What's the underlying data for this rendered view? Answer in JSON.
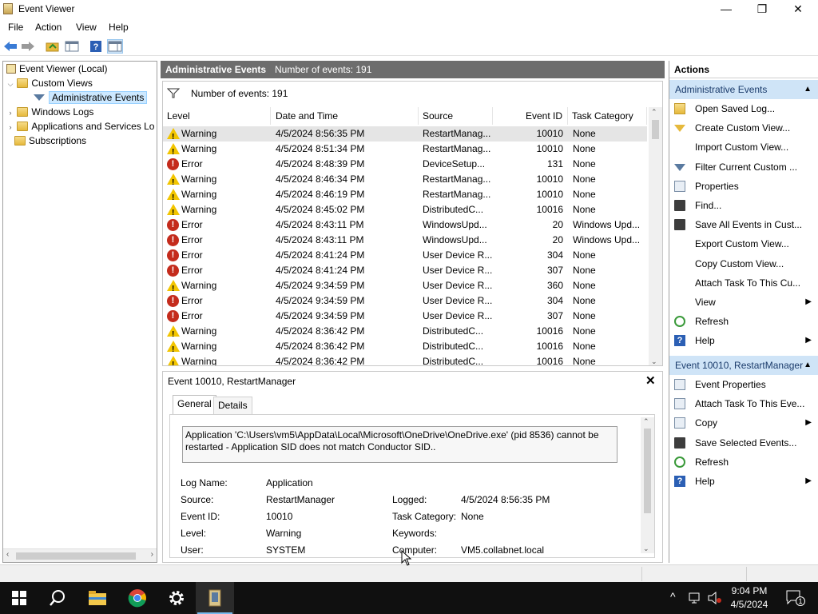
{
  "window": {
    "title": "Event Viewer",
    "minimize_glyph": "—",
    "maximize_glyph": "❐",
    "close_glyph": "✕"
  },
  "menu": [
    "File",
    "Action",
    "View",
    "Help"
  ],
  "toolbar": {
    "icons": [
      "back-arrow-icon",
      "forward-arrow-icon",
      "open-folder-icon",
      "show-hide-tree-icon",
      "help-icon",
      "show-hide-action-pane-icon"
    ]
  },
  "tree": {
    "root": "Event Viewer (Local)",
    "custom_views": "Custom Views",
    "administrative_events": "Administrative Events",
    "windows_logs": "Windows Logs",
    "apps_services": "Applications and Services Lo",
    "subscriptions": "Subscriptions"
  },
  "middle": {
    "header_title": "Administrative Events",
    "header_count": "Number of events: 191",
    "filter_text": "Number of events: 191",
    "columns": {
      "level": "Level",
      "date": "Date and Time",
      "source": "Source",
      "event_id": "Event ID",
      "task": "Task Category"
    },
    "events": [
      {
        "level": "Warning",
        "date": "4/5/2024 8:56:35 PM",
        "source": "RestartManag...",
        "id": "10010",
        "task": "None"
      },
      {
        "level": "Warning",
        "date": "4/5/2024 8:51:34 PM",
        "source": "RestartManag...",
        "id": "10010",
        "task": "None"
      },
      {
        "level": "Error",
        "date": "4/5/2024 8:48:39 PM",
        "source": "DeviceSetup...",
        "id": "131",
        "task": "None"
      },
      {
        "level": "Warning",
        "date": "4/5/2024 8:46:34 PM",
        "source": "RestartManag...",
        "id": "10010",
        "task": "None"
      },
      {
        "level": "Warning",
        "date": "4/5/2024 8:46:19 PM",
        "source": "RestartManag...",
        "id": "10010",
        "task": "None"
      },
      {
        "level": "Warning",
        "date": "4/5/2024 8:45:02 PM",
        "source": "DistributedC...",
        "id": "10016",
        "task": "None"
      },
      {
        "level": "Error",
        "date": "4/5/2024 8:43:11 PM",
        "source": "WindowsUpd...",
        "id": "20",
        "task": "Windows Upd..."
      },
      {
        "level": "Error",
        "date": "4/5/2024 8:43:11 PM",
        "source": "WindowsUpd...",
        "id": "20",
        "task": "Windows Upd..."
      },
      {
        "level": "Error",
        "date": "4/5/2024 8:41:24 PM",
        "source": "User Device R...",
        "id": "304",
        "task": "None"
      },
      {
        "level": "Error",
        "date": "4/5/2024 8:41:24 PM",
        "source": "User Device R...",
        "id": "307",
        "task": "None"
      },
      {
        "level": "Warning",
        "date": "4/5/2024 9:34:59 PM",
        "source": "User Device R...",
        "id": "360",
        "task": "None"
      },
      {
        "level": "Error",
        "date": "4/5/2024 9:34:59 PM",
        "source": "User Device R...",
        "id": "304",
        "task": "None"
      },
      {
        "level": "Error",
        "date": "4/5/2024 9:34:59 PM",
        "source": "User Device R...",
        "id": "307",
        "task": "None"
      },
      {
        "level": "Warning",
        "date": "4/5/2024 8:36:42 PM",
        "source": "DistributedC...",
        "id": "10016",
        "task": "None"
      },
      {
        "level": "Warning",
        "date": "4/5/2024 8:36:42 PM",
        "source": "DistributedC...",
        "id": "10016",
        "task": "None"
      },
      {
        "level": "Warning",
        "date": "4/5/2024 8:36:42 PM",
        "source": "DistributedC...",
        "id": "10016",
        "task": "None"
      }
    ]
  },
  "detail": {
    "title": "Event 10010, RestartManager",
    "close_glyph": "✕",
    "tab_general": "General",
    "tab_details": "Details",
    "message": "Application 'C:\\Users\\vm5\\AppData\\Local\\Microsoft\\OneDrive\\OneDrive.exe' (pid 8536) cannot be restarted - Application SID does not match Conductor SID..",
    "log_name_label": "Log Name:",
    "log_name_value": "Application",
    "source_label": "Source:",
    "source_value": "RestartManager",
    "logged_label": "Logged:",
    "logged_value": "4/5/2024 8:56:35 PM",
    "event_id_label": "Event ID:",
    "event_id_value": "10010",
    "task_label": "Task Category:",
    "task_value": "None",
    "level_label": "Level:",
    "level_value": "Warning",
    "keywords_label": "Keywords:",
    "user_label": "User:",
    "user_value": "SYSTEM",
    "computer_label": "Computer:",
    "computer_value": "VM5.collabnet.local"
  },
  "actions": {
    "header": "Actions",
    "section1": "Administrative Events",
    "items1": [
      {
        "label": "Open Saved Log...",
        "icon": "open-folder-icon"
      },
      {
        "label": "Create Custom View...",
        "icon": "funnel-yellow-icon"
      },
      {
        "label": "Import Custom View...",
        "icon": ""
      },
      {
        "label": "Filter Current Custom ...",
        "icon": "funnel-icon"
      },
      {
        "label": "Properties",
        "icon": "properties-icon"
      },
      {
        "label": "Find...",
        "icon": "binoculars-icon"
      },
      {
        "label": "Save All Events in Cust...",
        "icon": "save-icon"
      },
      {
        "label": "Export Custom View...",
        "icon": ""
      },
      {
        "label": "Copy Custom View...",
        "icon": ""
      },
      {
        "label": "Attach Task To This Cu...",
        "icon": ""
      },
      {
        "label": "View",
        "icon": "",
        "submenu": true
      },
      {
        "label": "Refresh",
        "icon": "refresh-icon"
      },
      {
        "label": "Help",
        "icon": "help-icon",
        "submenu": true
      }
    ],
    "section2": "Event 10010, RestartManager",
    "items2": [
      {
        "label": "Event Properties",
        "icon": "properties-icon"
      },
      {
        "label": "Attach Task To This Eve...",
        "icon": "task-icon"
      },
      {
        "label": "Copy",
        "icon": "copy-icon",
        "submenu": true
      },
      {
        "label": "Save Selected Events...",
        "icon": "save-icon"
      },
      {
        "label": "Refresh",
        "icon": "refresh-icon"
      },
      {
        "label": "Help",
        "icon": "help-icon",
        "submenu": true
      }
    ]
  },
  "taskbar": {
    "time": "9:04 PM",
    "date": "4/5/2024",
    "notification_count": "1",
    "apps": [
      "start-icon",
      "search-icon",
      "file-explorer-icon",
      "chrome-icon",
      "settings-icon",
      "event-viewer-icon"
    ]
  },
  "colors": {
    "section_bg": "#cfe4f7",
    "header_bg": "#6d6d6d",
    "warning": "#f2c500",
    "error": "#c42b1c",
    "taskbar": "#101010"
  }
}
